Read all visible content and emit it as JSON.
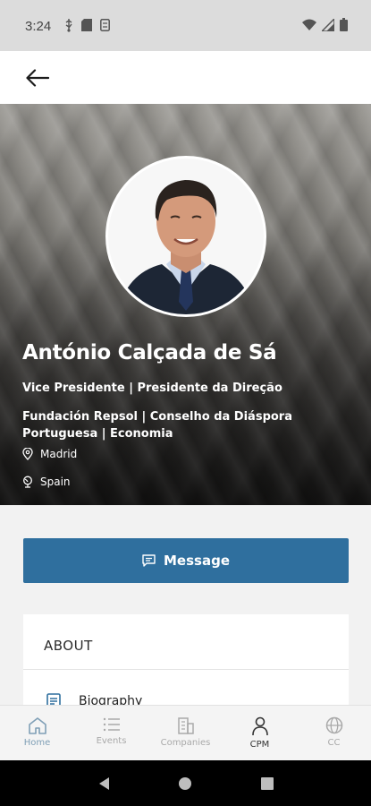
{
  "status_bar": {
    "time": "3:24",
    "left_icons": [
      "usb-icon",
      "sd-card-icon",
      "sim-icon"
    ],
    "right_icons": [
      "wifi-icon",
      "signal-icon",
      "battery-icon"
    ]
  },
  "app_bar": {
    "back_icon": "arrow-left-icon"
  },
  "profile": {
    "name": "António Calçada de Sá",
    "title": "Vice Presidente | Presidente da Direção",
    "organizations": "Fundación Repsol | Conselho da Diáspora Portuguesa | Economia",
    "city": "Madrid",
    "country": "Spain"
  },
  "actions": {
    "message_label": "Message"
  },
  "about": {
    "heading": "ABOUT",
    "items": [
      {
        "label": "Biography",
        "icon": "document-icon"
      }
    ]
  },
  "bottom_nav": {
    "items": [
      {
        "label": "Home",
        "icon": "home-icon",
        "state": "home"
      },
      {
        "label": "Events",
        "icon": "list-icon",
        "state": "inactive"
      },
      {
        "label": "Companies",
        "icon": "building-icon",
        "state": "inactive"
      },
      {
        "label": "CPM",
        "icon": "person-icon",
        "state": "active"
      },
      {
        "label": "CC",
        "icon": "globe-icon",
        "state": "inactive"
      }
    ]
  },
  "colors": {
    "accent": "#2f6f9e",
    "status_bar_bg": "#dcdcdc",
    "page_bg": "#f2f2f2",
    "active_nav": "#333333",
    "inactive_nav": "#a9a9a9"
  }
}
